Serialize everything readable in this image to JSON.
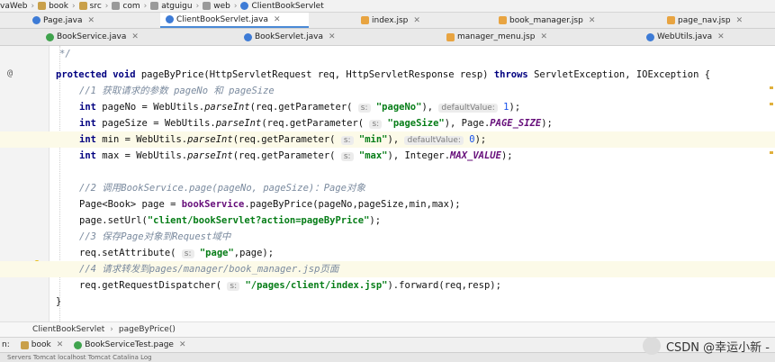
{
  "breadcrumb": [
    "vaWeb",
    "book",
    "src",
    "com",
    "atguigu",
    "web",
    "ClientBookServlet"
  ],
  "tabs_row1": [
    {
      "label": "Page.java",
      "icon": "class-icon",
      "active": false
    },
    {
      "label": "ClientBookServlet.java",
      "icon": "class-icon",
      "active": true
    },
    {
      "label": "index.jsp",
      "icon": "jsp-icon",
      "active": false
    },
    {
      "label": "book_manager.jsp",
      "icon": "jsp-icon",
      "active": false
    },
    {
      "label": "page_nav.jsp",
      "icon": "jsp-icon",
      "active": false
    }
  ],
  "tabs_row2": [
    {
      "label": "BookService.java",
      "icon": "interface-icon"
    },
    {
      "label": "BookServlet.java",
      "icon": "class-icon"
    },
    {
      "label": "manager_menu.jsp",
      "icon": "jsp-icon"
    },
    {
      "label": "WebUtils.java",
      "icon": "class-icon"
    }
  ],
  "code": {
    "l0_comment_end": "*/",
    "l1": {
      "p1": "protected",
      "p2": "void",
      "p3": "pageByPrice(HttpServletRequest req, HttpServletResponse resp)",
      "p4": "throws",
      "p5": "ServletException, IOException {"
    },
    "l2_comment": "//1 获取请求的参数 pageNo 和 pageSize",
    "l3": {
      "t": "int",
      "a": "pageNo = WebUtils.",
      "m": "parseInt",
      "b": "(req.getParameter(",
      "hint1": "s:",
      "s": "\"pageNo\"",
      "c": "),",
      "hint2": "defaultValue:",
      "n": "1",
      "d": ");"
    },
    "l4": {
      "t": "int",
      "a": "pageSize = WebUtils.",
      "m": "parseInt",
      "b": "(req.getParameter(",
      "hint1": "s:",
      "s": "\"pageSize\"",
      "c": "), Page.",
      "k": "PAGE_SIZE",
      "d": ");"
    },
    "l5": {
      "t": "int",
      "a": "min = WebUtils.",
      "m": "parseInt",
      "b": "(req.getParameter(",
      "hint1": "s:",
      "s": "\"min\"",
      "c": "),",
      "hint2": "defaultValue:",
      "n": "0",
      "d": ");"
    },
    "l6": {
      "t": "int",
      "a": "max = WebUtils.",
      "m": "parseInt",
      "b": "(req.getParameter(",
      "hint1": "s:",
      "s": "\"max\"",
      "c": "), Integer.",
      "k": "MAX_VALUE",
      "d": ");"
    },
    "l8_comment": "//2 调用BookService.page(pageNo, pageSize)：Page对象",
    "l9": {
      "a": "Page<Book> page = ",
      "f": "bookService",
      "b": ".pageByPrice(pageNo,pageSize,min,max);"
    },
    "l10": {
      "a": "page.setUrl(",
      "s": "\"client/bookServlet?action=pageByPrice\"",
      "b": ");"
    },
    "l11_comment": "//3 保存Page对象到Request域中",
    "l12": {
      "a": "req.setAttribute(",
      "hint1": "s:",
      "s": "\"page\"",
      "b": ",page);"
    },
    "l13_comment": "//4 请求转发到pages/manager/book_manager.jsp页面",
    "l14": {
      "a": "req.getRequestDispatcher(",
      "hint1": "s:",
      "s": "\"/pages/client/index.jsp\"",
      "b": ").forward(req,resp);"
    },
    "l15_close": "}"
  },
  "gutter": {
    "override_marker": "@"
  },
  "footer_breadcrumb": [
    "ClientBookServlet",
    "pageByPrice()"
  ],
  "run_bar": {
    "prefix": "n:",
    "items": [
      "book",
      "BookServiceTest.page"
    ]
  },
  "bottom_strip_text": "Servers   Tomcat localhost  Tomcat Catalina Log",
  "watermark": "CSDN @幸运小新 -",
  "colors": {
    "keyword": "#000080",
    "string": "#067d17",
    "comment": "#7a8a9e",
    "number": "#1750eb",
    "constant": "#660e7a",
    "active_tab_underline": "#4a8ad6"
  }
}
